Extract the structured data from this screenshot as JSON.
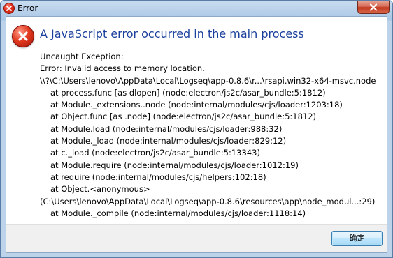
{
  "window": {
    "title": "Error"
  },
  "dialog": {
    "heading": "A JavaScript error occurred in the main process",
    "lines": [
      "Uncaught Exception:",
      "Error: Invalid access to memory location.",
      "\\\\?\\C:\\Users\\lenovo\\AppData\\Local\\Logseq\\app-0.8.6\\r...\\rsapi.win32-x64-msvc.node",
      "at process.func [as dlopen] (node:electron/js2c/asar_bundle:5:1812)",
      "at Module._extensions..node (node:internal/modules/cjs/loader:1203:18)",
      "at Object.func [as .node] (node:electron/js2c/asar_bundle:5:1812)",
      "at Module.load (node:internal/modules/cjs/loader:988:32)",
      "at Module._load (node:internal/modules/cjs/loader:829:12)",
      "at c._load (node:electron/js2c/asar_bundle:5:13343)",
      "at Module.require (node:internal/modules/cjs/loader:1012:19)",
      "at require (node:internal/modules/cjs/helpers:102:18)",
      "at Object.<anonymous>",
      "(C:\\Users\\lenovo\\AppData\\Local\\Logseq\\app-0.8.6\\resources\\app\\node_modul...:29)",
      "at Module._compile (node:internal/modules/cjs/loader:1118:14)"
    ],
    "ok_label": "确定"
  },
  "icons": {
    "title_icon": "error-icon",
    "close_icon": "close-icon",
    "dialog_icon": "error-icon"
  },
  "colors": {
    "heading": "#1a3f9c",
    "error_red": "#e23a20",
    "footer_bg": "#f0f0f0"
  }
}
